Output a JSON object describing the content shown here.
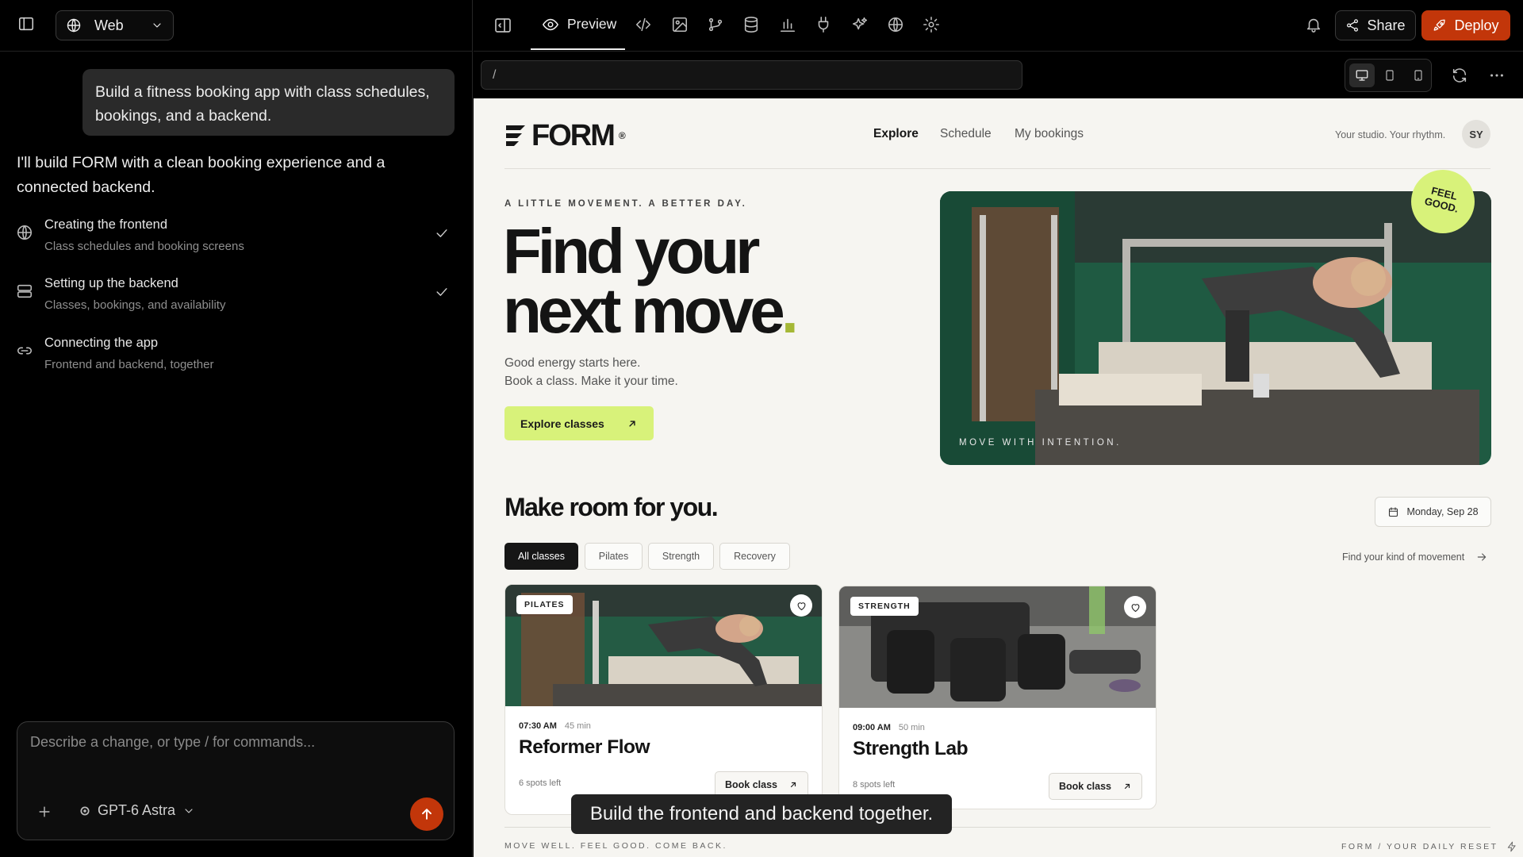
{
  "left": {
    "platform": "Web",
    "user_message": "Build a fitness booking app with class schedules, bookings, and a backend.",
    "ai_message": "I'll build FORM with a clean booking experience and a connected backend.",
    "steps": [
      {
        "title": "Creating the frontend",
        "subtitle": "Class schedules and booking screens",
        "done": true,
        "icon": "globe-icon"
      },
      {
        "title": "Setting up the backend",
        "subtitle": "Classes, bookings, and availability",
        "done": true,
        "icon": "server-icon"
      },
      {
        "title": "Connecting the app",
        "subtitle": "Frontend and backend, together",
        "done": false,
        "icon": "link-icon"
      }
    ],
    "composer_placeholder": "Describe a change, or type / for commands...",
    "model": "GPT-6 Astra"
  },
  "topbar": {
    "preview_label": "Preview",
    "share_label": "Share",
    "deploy_label": "Deploy",
    "url": "/",
    "accent": "#c2360a"
  },
  "site": {
    "brand": "FORM",
    "brand_mark": "®",
    "nav": [
      "Explore",
      "Schedule",
      "My bookings"
    ],
    "tagline": "Your studio. Your rhythm.",
    "avatar": "SY",
    "eyebrow": "A LITTLE MOVEMENT. A BETTER DAY.",
    "hero_line1": "Find your",
    "hero_line2": "next move",
    "hero_dot": ".",
    "hero_sub1": "Good energy starts here.",
    "hero_sub2": "Book a class. Make it your time.",
    "cta": "Explore classes",
    "hero_caption": "MOVE WITH INTENTION.",
    "badge_line1": "FEEL",
    "badge_line2": "GOOD.",
    "section_title": "Make room for you.",
    "date": "Monday, Sep 28",
    "filters": [
      "All classes",
      "Pilates",
      "Strength",
      "Recovery"
    ],
    "find_link": "Find your kind of movement",
    "accent_green": "#d8f27a",
    "classes": [
      {
        "tag": "PILATES",
        "time": "07:30 AM",
        "duration": "45 min",
        "name": "Reformer Flow",
        "spots": "6 spots left",
        "book": "Book class"
      },
      {
        "tag": "STRENGTH",
        "time": "09:00 AM",
        "duration": "50 min",
        "name": "Strength Lab",
        "spots": "8 spots left",
        "book": "Book class"
      }
    ],
    "footer_left": "MOVE WELL. FEEL GOOD. COME BACK.",
    "footer_right": "FORM / YOUR DAILY RESET"
  },
  "tooltip": "Build the frontend and backend together."
}
